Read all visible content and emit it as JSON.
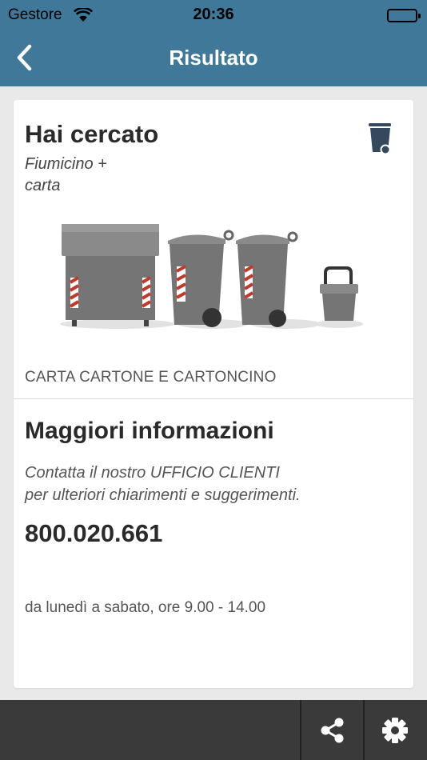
{
  "status_bar": {
    "carrier": "Gestore",
    "time": "20:36"
  },
  "nav": {
    "title": "Risultato",
    "back_icon": "chevron-left-icon"
  },
  "result": {
    "heading": "Hai cercato",
    "query_line1": "Fiumicino +",
    "query_line2": "carta",
    "icon": "trash-bin-icon",
    "category": "CARTA CARTONE E CARTONCINO"
  },
  "info": {
    "heading": "Maggiori informazioni",
    "contact_line1": "Contatta il nostro UFFICIO CLIENTI",
    "contact_line2": "per ulteriori chiarimenti e suggerimenti.",
    "phone": "800.020.661",
    "hours": "da lunedì a sabato, ore 9.00 - 14.00"
  },
  "toolbar": {
    "share_icon": "share-icon",
    "settings_icon": "gear-icon"
  },
  "colors": {
    "nav_bg": "#3f7898",
    "toolbar_bg": "#3a3a3a",
    "bin_gray": "#757575"
  }
}
